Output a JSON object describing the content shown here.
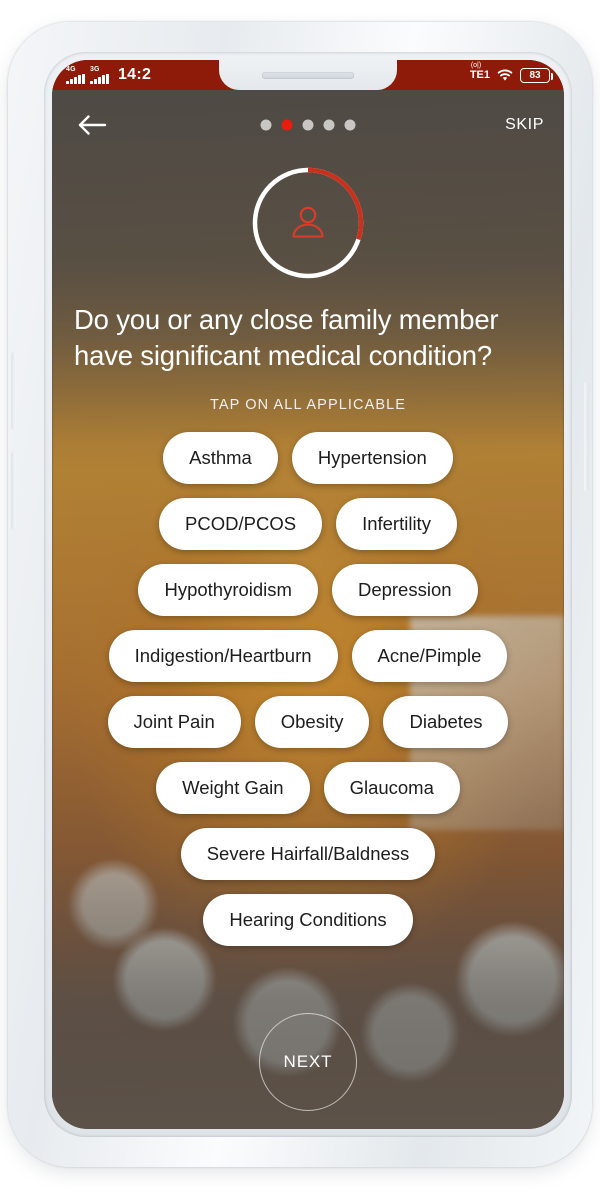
{
  "status_bar": {
    "network_1_label": "4G",
    "network_2_label": "3G",
    "time": "14:2",
    "carrier": "TE1",
    "volte_label": "(o|)",
    "wifi_icon": "wifi-icon",
    "battery_percent": "83"
  },
  "header": {
    "back_icon": "back-arrow-icon",
    "skip_label": "SKIP",
    "dots_total": 5,
    "dots_active_index": 1,
    "active_dot_color": "#e81d0e",
    "inactive_dot_color": "#c9c7c4"
  },
  "avatar": {
    "icon": "person-icon",
    "icon_color": "#e03a2a",
    "progress_percent": 30,
    "track_color": "#ffffff",
    "progress_color": "#c9311d"
  },
  "question": {
    "title": "Do you or any close family member have significant medical condition?",
    "subtitle": "TAP ON ALL APPLICABLE"
  },
  "chip_rows": [
    [
      "Asthma",
      "Hypertension"
    ],
    [
      "PCOD/PCOS",
      "Infertility"
    ],
    [
      "Hypothyroidism",
      "Depression"
    ],
    [
      "Indigestion/Heartburn",
      "Acne/Pimple"
    ],
    [
      "Joint Pain",
      "Obesity",
      "Diabetes"
    ],
    [
      "Weight Gain",
      "Glaucoma"
    ],
    [
      "Severe Hairfall/Baldness"
    ],
    [
      "Hearing Conditions"
    ]
  ],
  "footer": {
    "next_label": "NEXT"
  }
}
